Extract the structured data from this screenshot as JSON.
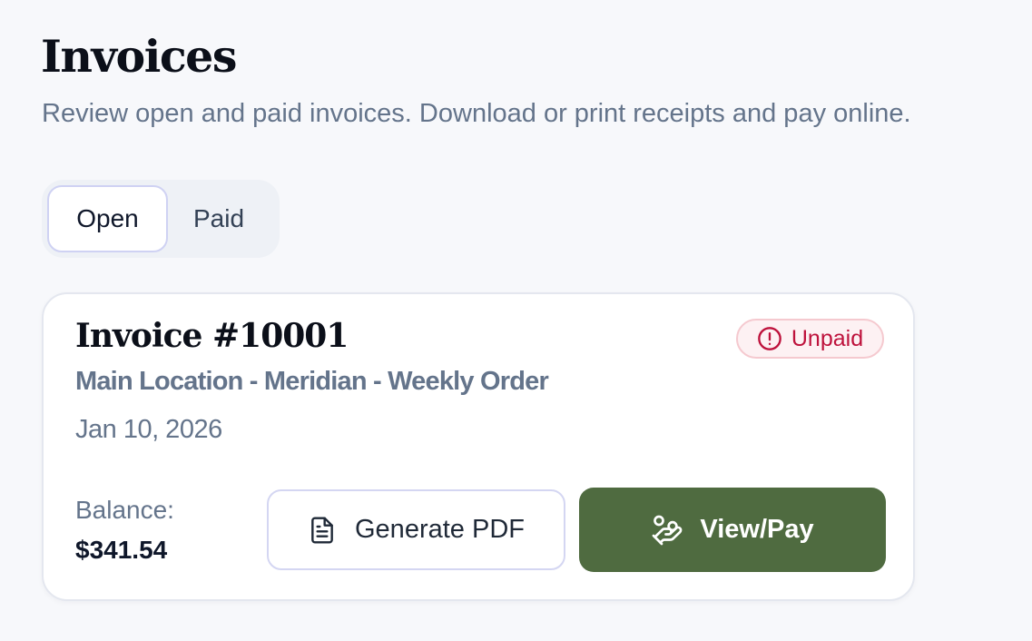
{
  "header": {
    "title": "Invoices",
    "subtitle": "Review open and paid invoices. Download or print receipts and pay online."
  },
  "tabs": [
    {
      "label": "Open",
      "selected": true
    },
    {
      "label": "Paid",
      "selected": false
    }
  ],
  "invoice": {
    "title": "Invoice #10001",
    "status": "Unpaid",
    "location": "Main Location - Meridian - Weekly Order",
    "date": "Jan 10, 2026",
    "balance_label": "Balance:",
    "balance_value": "$341.54",
    "pdf_button_label": "Generate PDF",
    "pay_button_label": "View/Pay"
  },
  "icons": {
    "status": "alert-circle-icon",
    "pdf": "document-icon",
    "pay": "hand-coins-icon"
  },
  "colors": {
    "accent": "#4f6b40",
    "status_unpaid": "#be123c",
    "status_unpaid_bg": "#fdf1f3",
    "muted_text": "#64748b"
  }
}
